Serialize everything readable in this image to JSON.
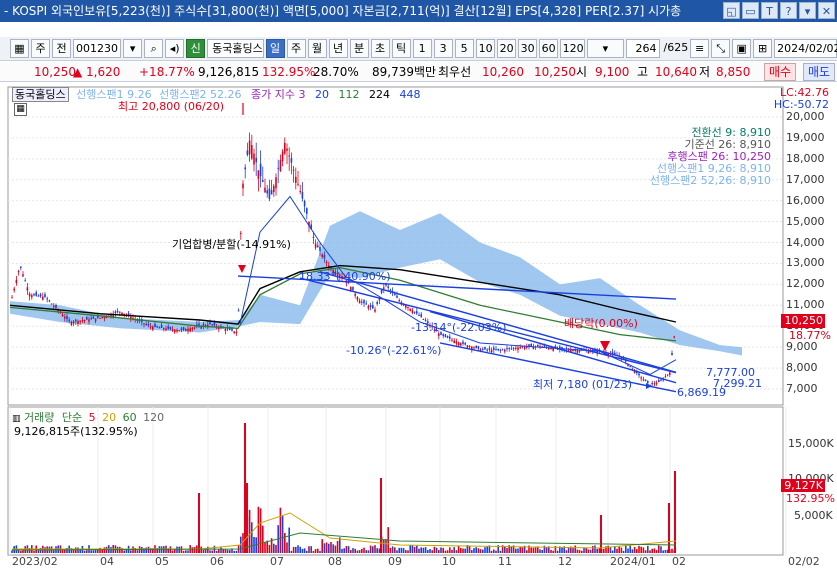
{
  "titlebar": {
    "text": "- KOSPI  외국인보유[5,223(천)]  주식수[31,800(천)]  액면[5,000]  자본금[2,711(억)]  결산[12월]  EPS[4,328]  PER[2.37]  시가총",
    "icons": [
      "window-icon",
      "restore-icon",
      "font-icon",
      "help-icon",
      "dropdown-icon",
      "close-icon"
    ],
    "icon_glyphs": [
      "◱",
      "▭",
      "T",
      "?",
      "▾",
      "✕"
    ]
  },
  "toolbar": {
    "type_btn": "주",
    "prev_btn": "전",
    "code": "001230",
    "name_prefix": "신",
    "name": "동국홀딩스",
    "periods": [
      "일",
      "주",
      "월",
      "년",
      "분",
      "초",
      "틱"
    ],
    "selected_period": "일",
    "nums": [
      "1",
      "3",
      "5",
      "10",
      "20",
      "30",
      "60",
      "120"
    ],
    "count": "264",
    "total": "/625",
    "date": "2024/02/02"
  },
  "quote": {
    "price": "10,250",
    "change": "▲  1,620",
    "rate": "+18.77%",
    "volume": "9,126,815",
    "vol_ratio": "132.95%",
    "turnover": "28.70%",
    "amount": "89,739백만",
    "pref_label": "최우선",
    "ask": "10,260",
    "bid": "10,250",
    "open_label": "시",
    "open": "9,100",
    "high_label": "고",
    "high": "10,640",
    "low_label": "저",
    "low": "8,850",
    "buy": "매수",
    "sell": "매도"
  },
  "legend": {
    "name": "동국홀딩스",
    "span1": "선행스팬1 9.26",
    "span2": "선행스팬2 52.26",
    "close_label": "종가 지수 3",
    "ma": [
      "20",
      "112",
      "224",
      "448"
    ],
    "lc": "LC:42.76",
    "hc": "HC:-50.72"
  },
  "ichimoku": {
    "conv": "전환선 9: 8,910",
    "base": "기준선 26: 8,910",
    "lag": "후행스팬 26: 10,250",
    "lead1": "선행스팬1 9,26: 8,910",
    "lead2": "선행스팬2 52,26: 8,910"
  },
  "annotations": {
    "high": "최고 20,800 (06/20)",
    "merge": "기업합병/분할(-14.91%)",
    "angle1": "18.33°(-40.90%)",
    "angle2": "-13.14°(-22.03%)",
    "angle3": "-10.26°(-22.61%)",
    "dividend": "배당락(0.00%)",
    "low": "최저 7,180 (01/23)",
    "t1": "7,777.00",
    "t2": "7,299.21",
    "t3": "6,869.19"
  },
  "price_axis": [
    "20,000",
    "19,000",
    "18,000",
    "17,000",
    "16,000",
    "15,000",
    "14,000",
    "13,000",
    "12,000",
    "11,000",
    "10,000",
    "9,000",
    "8,000",
    "7,000"
  ],
  "price_tag": {
    "price": "10,250",
    "rate": "18.77%"
  },
  "volume": {
    "title": "거래량",
    "ma_label": "단순",
    "ma": [
      "5",
      "20",
      "60",
      "120"
    ],
    "current": "9,126,815주(132.95%)",
    "axis": [
      "15,000K",
      "10,000K",
      "5,000K"
    ],
    "tag": "9,127K",
    "tag_rate": "132.95%"
  },
  "x_axis": [
    "2023/02",
    "04",
    "05",
    "06",
    "07",
    "08",
    "09",
    "10",
    "11",
    "12",
    "2024/01",
    "02",
    "02/02"
  ],
  "colors": {
    "up": "#e0001b",
    "down": "#1a3fe0",
    "cloud": "#7fb4ea",
    "black_ma": "#000000",
    "green_ma": "#2e7d32"
  }
}
